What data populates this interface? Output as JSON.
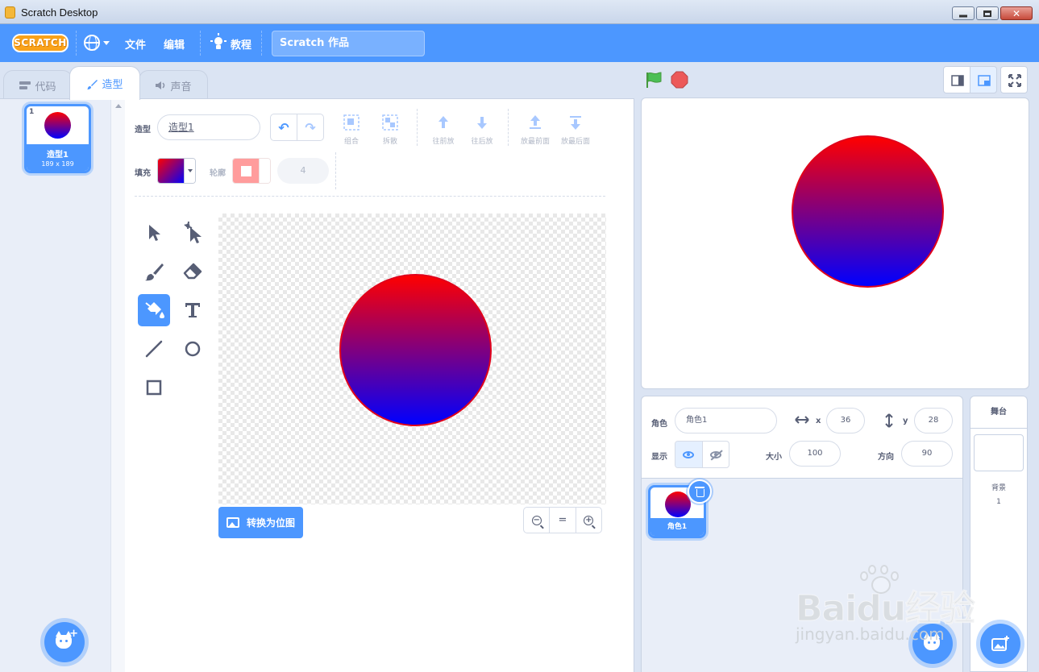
{
  "window": {
    "title": "Scratch Desktop"
  },
  "menubar": {
    "logo": "SCRATCH",
    "file": "文件",
    "edit": "编辑",
    "tutorials": "教程",
    "project_title": "Scratch 作品"
  },
  "tabs": [
    {
      "label": "代码",
      "active": false
    },
    {
      "label": "造型",
      "active": true
    },
    {
      "label": "声音",
      "active": false
    }
  ],
  "costumes": [
    {
      "index": "1",
      "name": "造型1",
      "size": "189 x 189"
    }
  ],
  "paint_editor": {
    "costume_label": "造型",
    "costume_name": "造型1",
    "actions": {
      "group": "组合",
      "ungroup": "拆散",
      "forward": "往前放",
      "backward": "往后放",
      "front": "放最前面",
      "back": "放最后面"
    },
    "fill_label": "填充",
    "outline_label": "轮廓",
    "outline_width": "4",
    "convert_button": "转换为位图",
    "zoom_reset": "="
  },
  "sprite_info": {
    "sprite_label": "角色",
    "sprite_name": "角色1",
    "x_label": "x",
    "x": "36",
    "y_label": "y",
    "y": "28",
    "show_label": "显示",
    "size_label": "大小",
    "size": "100",
    "direction_label": "方向",
    "direction": "90"
  },
  "sprites": [
    {
      "name": "角色1"
    }
  ],
  "stage_target": {
    "title": "舞台",
    "backdrops_label": "背景",
    "backdrops_count": "1"
  },
  "watermark": {
    "brand": "Baidu经验",
    "url": "jingyan.baidu.com"
  },
  "colors": {
    "primary": "#4c97ff",
    "gradient_top": "#ff0000",
    "gradient_bottom": "#0000ff",
    "flag": "#4cbf56",
    "stop": "#ec5959"
  }
}
